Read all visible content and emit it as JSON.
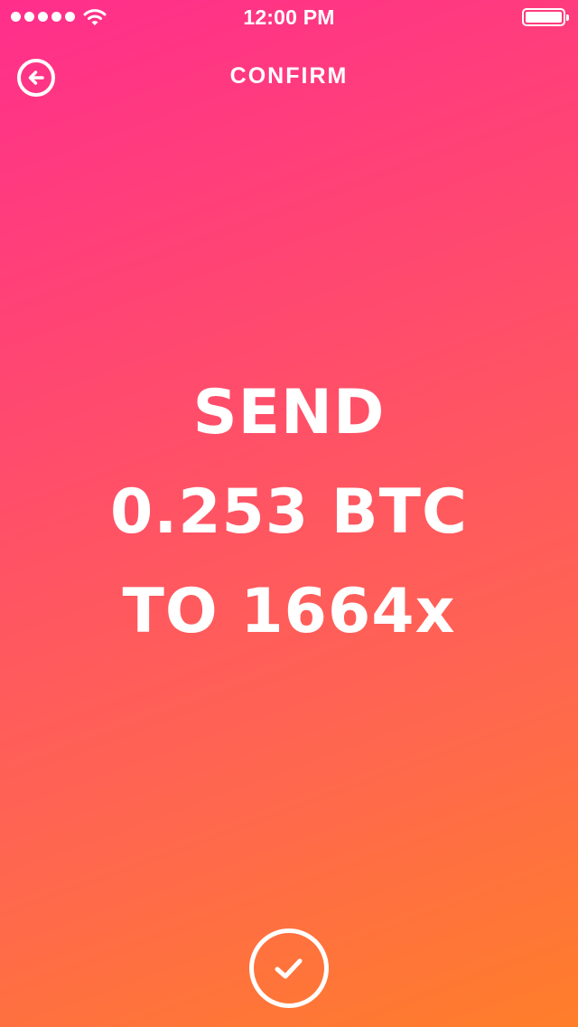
{
  "status_bar": {
    "time": "12:00 PM",
    "signal_icon": "signal-dots-icon",
    "wifi_icon": "wifi-icon",
    "battery_icon": "battery-icon",
    "battery_level": 1.0
  },
  "nav": {
    "title": "CONFIRM",
    "back_icon": "arrow-left-circle-icon"
  },
  "message": {
    "line1": "SEND",
    "line2": "0.253 BTC",
    "line3": "TO 1664x"
  },
  "confirm": {
    "icon": "checkmark-circle-icon"
  },
  "colors": {
    "gradient_top": "#ff2e8c",
    "gradient_bottom": "#ff7e2a",
    "foreground": "#ffffff"
  }
}
